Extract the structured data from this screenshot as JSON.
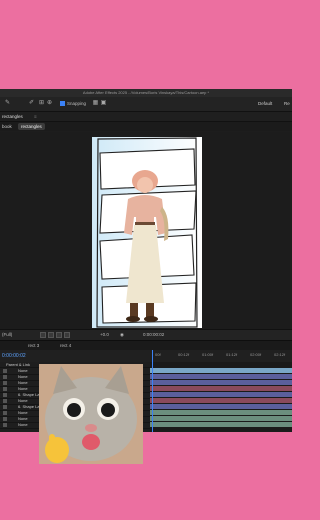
{
  "app": {
    "title": "Adobe After Effects 2025 - /Volumes/Boris Vinskaya/This/Cartoon.aep *",
    "snapping_label": "Snapping",
    "workspaces": [
      "Default",
      "Re"
    ]
  },
  "composition": {
    "panel_label": "rectangles",
    "close_glyph": "≡",
    "breadcrumbs": [
      "book",
      "rectangles"
    ]
  },
  "viewer_bar": {
    "zoom": "(Full)",
    "resolution": "+0.0",
    "timecode": "0:00:00:02"
  },
  "timeline": {
    "tabs": [
      "rect 3",
      "rect 4"
    ],
    "current_time": "0:00:00:02",
    "ruler": [
      "00f",
      "00:12f",
      "01:00f",
      "01:12f",
      "02:00f",
      "02:12f"
    ],
    "layers": [
      {
        "name": "None"
      },
      {
        "name": "None"
      },
      {
        "name": "None"
      },
      {
        "name": "None"
      },
      {
        "name": "6. Shape La"
      },
      {
        "name": "None"
      },
      {
        "name": "6. Shape La"
      },
      {
        "name": "None"
      },
      {
        "name": "None"
      },
      {
        "name": "None"
      }
    ],
    "layer_header": "Parent & Link",
    "bar_colors": [
      "#7aa7c7",
      "#5b5f9c",
      "#5b5f9c",
      "#8a4a5c",
      "#5b5f9c",
      "#8a4a5c",
      "#5b5f9c",
      "#6b8e7e",
      "#6b8e7e",
      "#6b8e7e"
    ]
  },
  "icons": [
    "pointer-icon",
    "pen-icon",
    "snapping-checkbox",
    "play-icon",
    "camera-icon"
  ],
  "colors": {
    "background": "#ec6fa0",
    "accent": "#3b82f6"
  }
}
